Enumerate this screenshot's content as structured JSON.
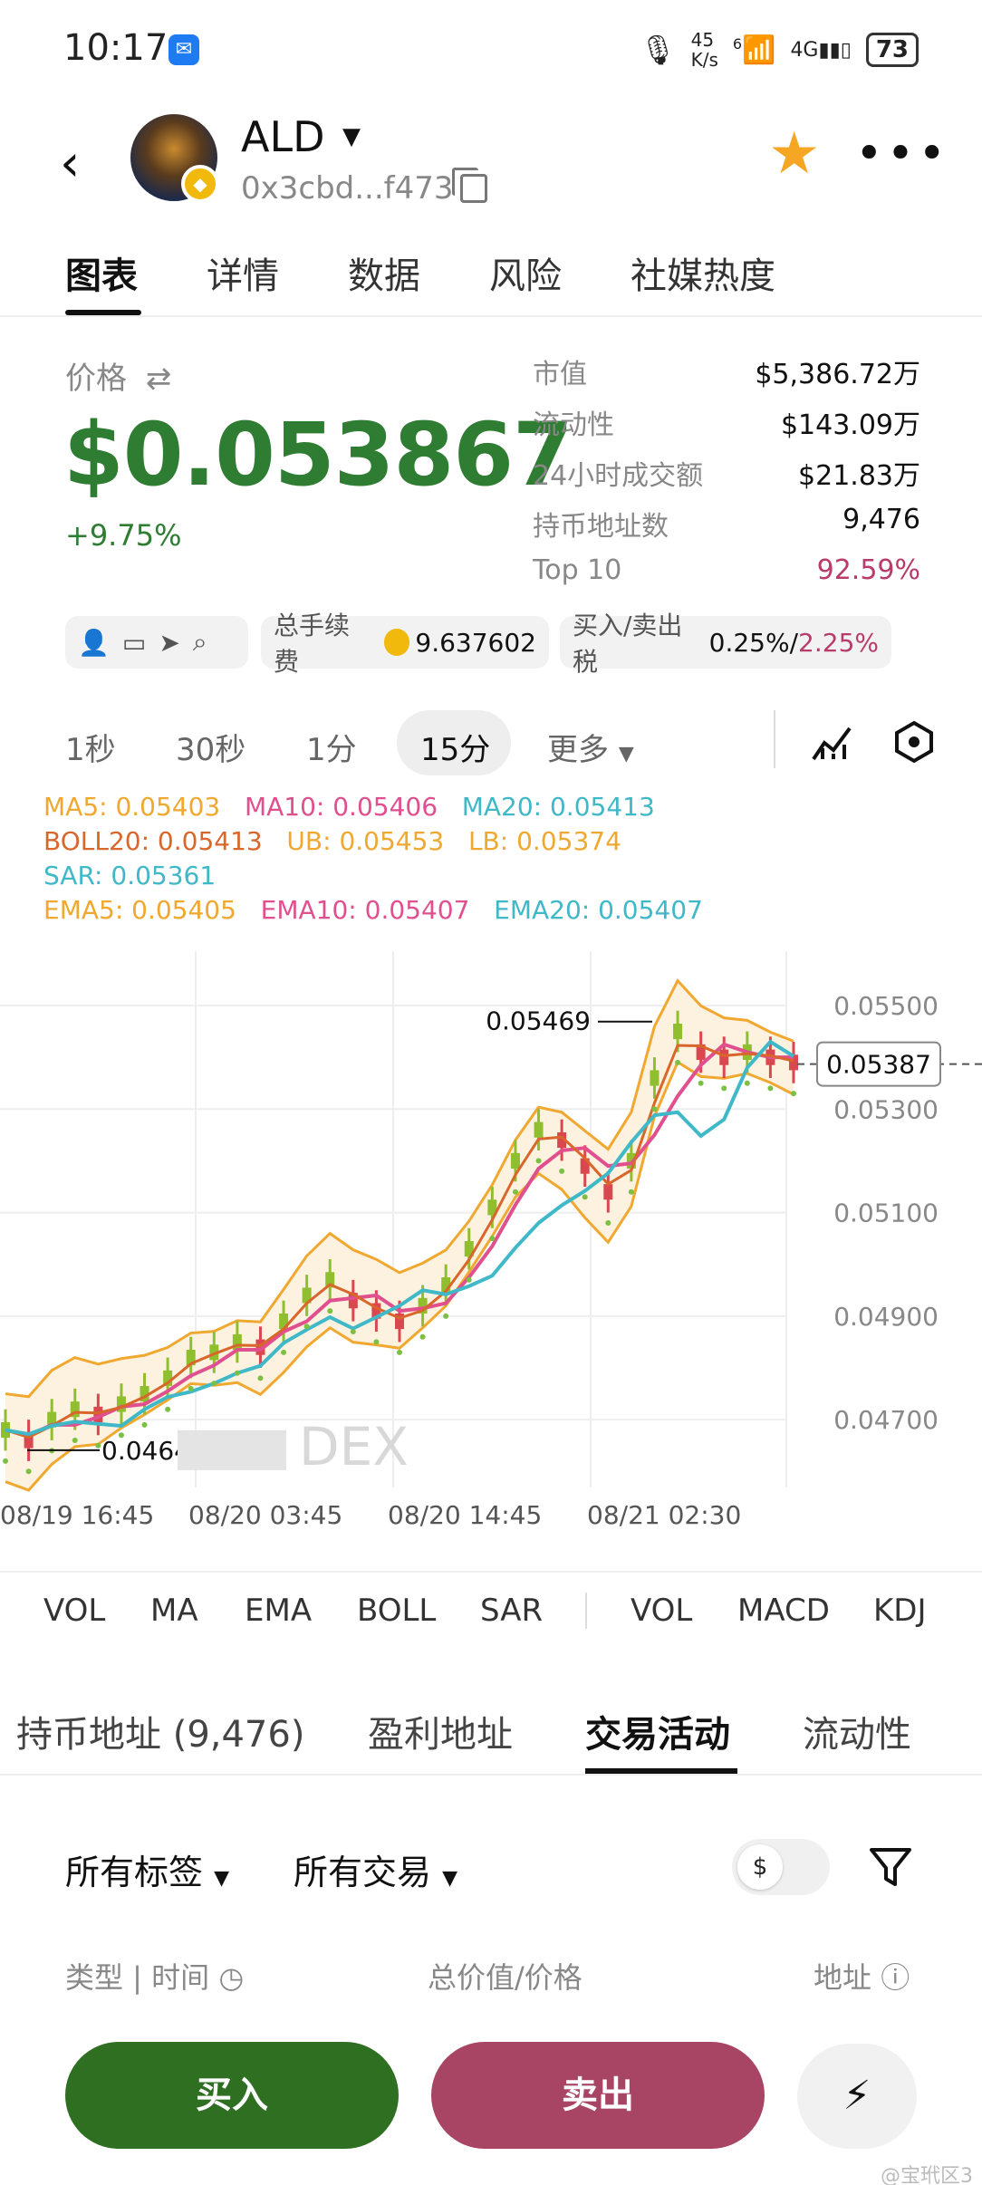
{
  "status_bar": {
    "time": "10:17",
    "net_speed_top": "45",
    "net_speed_unit": "K/s",
    "wifi_label": "6",
    "cell_label": "4G",
    "battery": "73"
  },
  "header": {
    "token_name": "ALD",
    "token_address": "0x3cbd...f473",
    "favorite_color": "#f5a623"
  },
  "tabs": [
    "图表",
    "详情",
    "数据",
    "风险",
    "社媒热度"
  ],
  "price": {
    "label": "价格",
    "value": "$0.053867",
    "change": "+9.75%",
    "color": "#2e7d32"
  },
  "stats": [
    {
      "label": "市值",
      "value": "$5,386.72万"
    },
    {
      "label": "流动性",
      "value": "$143.09万"
    },
    {
      "label": "24小时成交额",
      "value": "$21.83万"
    },
    {
      "label": "持币地址数",
      "value": "9,476"
    },
    {
      "label": "Top 10",
      "value": "92.59%"
    }
  ],
  "pills": {
    "fee_label": "总手续费",
    "fee_value": "9.637602",
    "tax_label": "买入/卖出税",
    "buy_tax": "0.25%",
    "sep": "/",
    "sell_tax": "2.25%"
  },
  "intervals": [
    "1秒",
    "30秒",
    "1分",
    "15分",
    "更多"
  ],
  "indicators": {
    "line1": [
      {
        "text": "MA5: 0.05403",
        "color": "#f0a830"
      },
      {
        "text": "MA10: 0.05406",
        "color": "#e0508f"
      },
      {
        "text": "MA20: 0.05413",
        "color": "#3fb8c8"
      }
    ],
    "line2": [
      {
        "text": "BOLL20: 0.05413",
        "color": "#d9662a"
      },
      {
        "text": "UB: 0.05453",
        "color": "#f0a830"
      },
      {
        "text": "LB: 0.05374",
        "color": "#f0a830"
      }
    ],
    "line3": [
      {
        "text": "SAR: 0.05361",
        "color": "#3fb8c8"
      }
    ],
    "line4": [
      {
        "text": "EMA5: 0.05405",
        "color": "#f0a830"
      },
      {
        "text": "EMA10: 0.05407",
        "color": "#e0508f"
      },
      {
        "text": "EMA20: 0.05407",
        "color": "#3fb8c8"
      }
    ]
  },
  "chart_data": {
    "type": "line",
    "y_ticks": [
      "0.05500",
      "0.05300",
      "0.05100",
      "0.04900",
      "0.04700"
    ],
    "x_ticks": [
      "08/19 16:45",
      "08/20 03:45",
      "08/20 14:45",
      "08/21 02:30"
    ],
    "ylim": [
      0.0459,
      0.0557
    ],
    "high_label": "0.05469",
    "low_label": "0.04641",
    "current_price": "0.05387",
    "series": [
      {
        "name": "MA5",
        "values": [
          0.0468,
          0.0466,
          0.047,
          0.0472,
          0.0471,
          0.0473,
          0.0475,
          0.0478,
          0.0482,
          0.0483,
          0.0485,
          0.0484,
          0.0489,
          0.0494,
          0.0497,
          0.0493,
          0.0491,
          0.0489,
          0.0492,
          0.0496,
          0.0503,
          0.0511,
          0.052,
          0.0526,
          0.0524,
          0.0519,
          0.0514,
          0.052,
          0.0536,
          0.0545,
          0.0541,
          0.054,
          0.0541,
          0.054,
          0.0539
        ]
      }
    ]
  },
  "watermark": "DEX",
  "ind_tabs_main": [
    "VOL",
    "MA",
    "EMA",
    "BOLL",
    "SAR"
  ],
  "ind_tabs_sub": [
    "VOL",
    "MACD",
    "KDJ"
  ],
  "section_tabs": [
    "持币地址 (9,476)",
    "盈利地址",
    "交易活动",
    "流动性"
  ],
  "filters": {
    "tags": "所有标签",
    "trades": "所有交易",
    "currency": "$"
  },
  "columns": {
    "type_time": "类型 | 时间",
    "total": "总价值/价格",
    "address": "地址"
  },
  "buttons": {
    "buy": "买入",
    "sell": "卖出"
  },
  "corner_watermark": "@宝玳区3"
}
